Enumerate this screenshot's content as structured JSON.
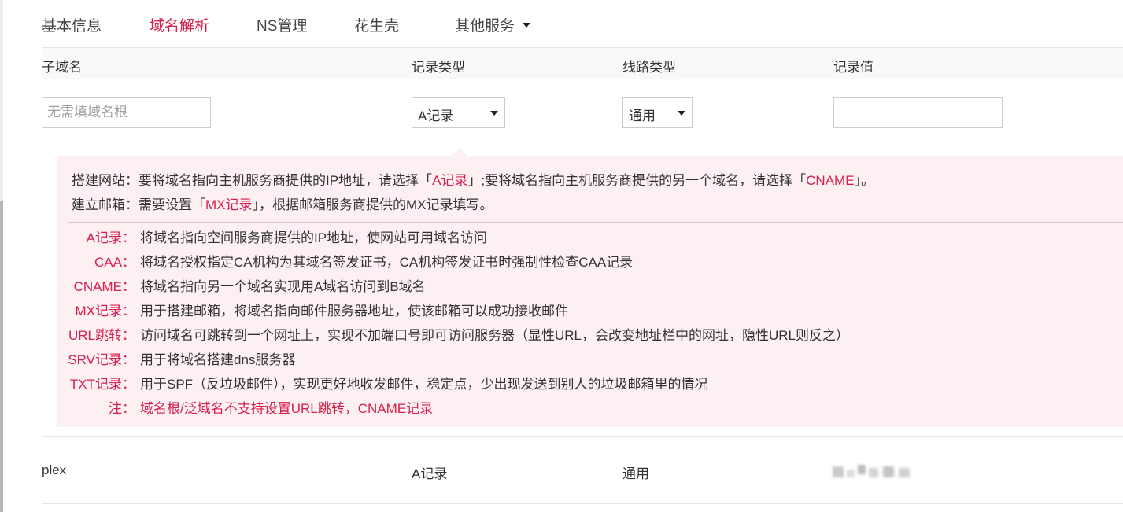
{
  "tabs": [
    {
      "label": "基本信息",
      "active": false
    },
    {
      "label": "域名解析",
      "active": true
    },
    {
      "label": "NS管理",
      "active": false
    },
    {
      "label": "花生壳",
      "active": false
    },
    {
      "label": "其他服务",
      "active": false,
      "dropdown": true
    }
  ],
  "table": {
    "headers": {
      "subdomain": "子域名",
      "record_type": "记录类型",
      "line_type": "线路类型",
      "record_value": "记录值"
    }
  },
  "form": {
    "subdomain_placeholder": "无需填域名根",
    "subdomain_value": "",
    "record_type_selected": "A记录",
    "line_type_selected": "通用",
    "record_value": ""
  },
  "help": {
    "intro": [
      {
        "prefix": "搭建网站：要将域名指向主机服务商提供的IP地址，请选择「",
        "hl1": "A记录",
        "middle": "」;要将域名指向主机服务商提供的另一个域名，请选择「",
        "hl2": "CNAME",
        "suffix": "」。"
      },
      {
        "prefix": "建立邮箱：需要设置「",
        "hl1": "MX记录",
        "middle": "」，根据邮箱服务商提供的MX记录填写。",
        "hl2": "",
        "suffix": ""
      }
    ],
    "definitions": [
      {
        "key": "A记录：",
        "text": "将域名指向空间服务商提供的IP地址，使网站可用域名访问"
      },
      {
        "key": "CAA：",
        "text": "将域名授权指定CA机构为其域名签发证书，CA机构签发证书时强制性检查CAA记录"
      },
      {
        "key": "CNAME：",
        "text": "将域名指向另一个域名实现用A域名访问到B域名"
      },
      {
        "key": "MX记录：",
        "text": "用于搭建邮箱，将域名指向邮件服务器地址，使该邮箱可以成功接收邮件"
      },
      {
        "key": "URL跳转：",
        "text": "访问域名可跳转到一个网址上，实现不加端口号即可访问服务器（显性URL，会改变地址栏中的网址，隐性URL则反之）"
      },
      {
        "key": "SRV记录：",
        "text": "用于将域名搭建dns服务器"
      },
      {
        "key": "TXT记录：",
        "text": "用于SPF（反垃圾邮件），实现更好地收发邮件，稳定点，少出现发送到别人的垃圾邮箱里的情况"
      },
      {
        "key": "注：",
        "text": "域名根/泛域名不支持设置URL跳转，CNAME记录"
      }
    ]
  },
  "records": [
    {
      "subdomain": "plex",
      "record_type": "A记录",
      "line_type": "通用",
      "record_value": "(blurred)"
    }
  ],
  "colors": {
    "accent": "#d6204b",
    "help_bg": "#fdf0f3"
  }
}
